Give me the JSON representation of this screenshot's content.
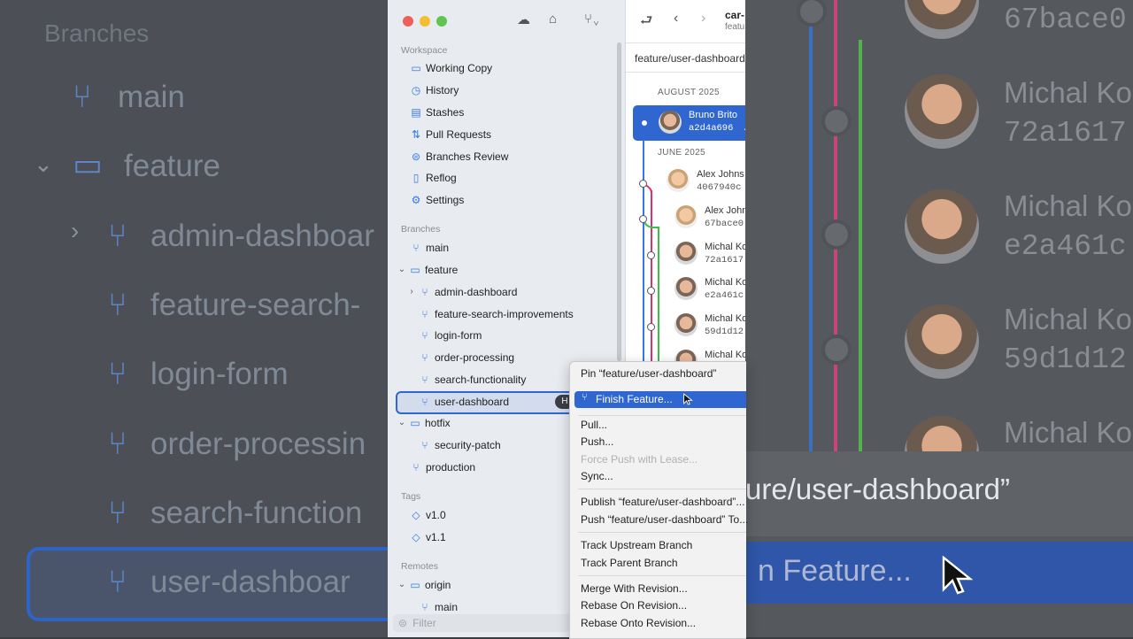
{
  "backdrop_left": {
    "header": "Branches",
    "items": [
      "main",
      "feature",
      "admin-dashboar",
      "feature-search-",
      "login-form",
      "order-processin",
      "search-function",
      "user-dashboar"
    ]
  },
  "backdrop_right": {
    "hashes": [
      "67bace0",
      "72a1617",
      "e2a461c",
      "59d1d12"
    ],
    "names": [
      "Michal Ko",
      "Michal Ko",
      "Michal Ko",
      "Michal Ko"
    ],
    "band_text": "ure/user-dashboard”",
    "selected_text": "n Feature..."
  },
  "sidebar": {
    "workspace_header": "Workspace",
    "workspace": [
      {
        "label": "Working Copy",
        "icon": "folder-icon"
      },
      {
        "label": "History",
        "icon": "clock-icon"
      },
      {
        "label": "Stashes",
        "icon": "clipboard-icon"
      },
      {
        "label": "Pull Requests",
        "icon": "pull-request-icon"
      },
      {
        "label": "Branches Review",
        "icon": "review-icon"
      },
      {
        "label": "Reflog",
        "icon": "book-icon"
      },
      {
        "label": "Settings",
        "icon": "gear-icon"
      }
    ],
    "branches_header": "Branches",
    "branches": {
      "main": "main",
      "feature": "feature",
      "admin_dashboard": "admin-dashboard",
      "feature_search": "feature-search-improvements",
      "login_form": "login-form",
      "order_processing": "order-processing",
      "search_functionality": "search-functionality",
      "user_dashboard": "user-dashboard",
      "user_dashboard_badge": "H",
      "hotfix": "hotfix",
      "security_patch": "security-patch",
      "production": "production"
    },
    "tags_header": "Tags",
    "tags": [
      "v1.0",
      "v1.1"
    ],
    "remotes_header": "Remotes",
    "remotes": {
      "origin": "origin",
      "main": "main"
    },
    "filter_placeholder": "Filter"
  },
  "content": {
    "repo_title": "car-",
    "repo_sub": "featu",
    "path": "feature/user-dashboard",
    "month1": "AUGUST 2025",
    "month2": "JUNE 2025",
    "commits": [
      {
        "name": "Bruno Brito",
        "hash": "a2d4a696",
        "tail": "A",
        "selected": true
      },
      {
        "name": "Alex Johns",
        "hash": "4067940c"
      },
      {
        "name": "Alex John",
        "hash": "67bace0"
      },
      {
        "name": "Michal Ko",
        "hash": "72a1617"
      },
      {
        "name": "Michal Ko",
        "hash": "e2a461c"
      },
      {
        "name": "Michal Ko",
        "hash": "59d1d12"
      },
      {
        "name": "Michal Ko",
        "hash": ""
      }
    ]
  },
  "menu": {
    "pin": "Pin “feature/user-dashboard”",
    "finish": "Finish Feature...",
    "pull": "Pull...",
    "push": "Push...",
    "force_push": "Force Push with Lease...",
    "sync": "Sync...",
    "publish": "Publish “feature/user-dashboard”...",
    "push_to": "Push “feature/user-dashboard” To...",
    "track_upstream": "Track Upstream Branch",
    "track_parent": "Track Parent Branch",
    "merge": "Merge With Revision...",
    "rebase_on": "Rebase On Revision...",
    "rebase_onto": "Rebase Onto Revision..."
  },
  "colors": {
    "accent": "#2f66d0",
    "graph_blue": "#3478e5",
    "graph_red": "#d9346d",
    "graph_green": "#3cbf4a"
  }
}
